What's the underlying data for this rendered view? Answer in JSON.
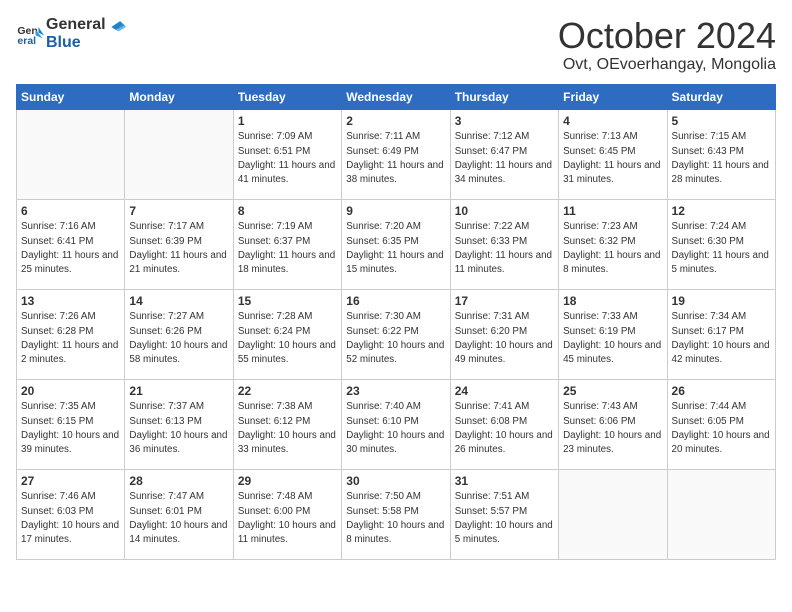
{
  "header": {
    "logo_line1": "General",
    "logo_line2": "Blue",
    "month": "October 2024",
    "location": "Ovt, OEvoerhangay, Mongolia"
  },
  "days_of_week": [
    "Sunday",
    "Monday",
    "Tuesday",
    "Wednesday",
    "Thursday",
    "Friday",
    "Saturday"
  ],
  "weeks": [
    [
      {
        "day": "",
        "info": ""
      },
      {
        "day": "",
        "info": ""
      },
      {
        "day": "1",
        "info": "Sunrise: 7:09 AM\nSunset: 6:51 PM\nDaylight: 11 hours and 41 minutes."
      },
      {
        "day": "2",
        "info": "Sunrise: 7:11 AM\nSunset: 6:49 PM\nDaylight: 11 hours and 38 minutes."
      },
      {
        "day": "3",
        "info": "Sunrise: 7:12 AM\nSunset: 6:47 PM\nDaylight: 11 hours and 34 minutes."
      },
      {
        "day": "4",
        "info": "Sunrise: 7:13 AM\nSunset: 6:45 PM\nDaylight: 11 hours and 31 minutes."
      },
      {
        "day": "5",
        "info": "Sunrise: 7:15 AM\nSunset: 6:43 PM\nDaylight: 11 hours and 28 minutes."
      }
    ],
    [
      {
        "day": "6",
        "info": "Sunrise: 7:16 AM\nSunset: 6:41 PM\nDaylight: 11 hours and 25 minutes."
      },
      {
        "day": "7",
        "info": "Sunrise: 7:17 AM\nSunset: 6:39 PM\nDaylight: 11 hours and 21 minutes."
      },
      {
        "day": "8",
        "info": "Sunrise: 7:19 AM\nSunset: 6:37 PM\nDaylight: 11 hours and 18 minutes."
      },
      {
        "day": "9",
        "info": "Sunrise: 7:20 AM\nSunset: 6:35 PM\nDaylight: 11 hours and 15 minutes."
      },
      {
        "day": "10",
        "info": "Sunrise: 7:22 AM\nSunset: 6:33 PM\nDaylight: 11 hours and 11 minutes."
      },
      {
        "day": "11",
        "info": "Sunrise: 7:23 AM\nSunset: 6:32 PM\nDaylight: 11 hours and 8 minutes."
      },
      {
        "day": "12",
        "info": "Sunrise: 7:24 AM\nSunset: 6:30 PM\nDaylight: 11 hours and 5 minutes."
      }
    ],
    [
      {
        "day": "13",
        "info": "Sunrise: 7:26 AM\nSunset: 6:28 PM\nDaylight: 11 hours and 2 minutes."
      },
      {
        "day": "14",
        "info": "Sunrise: 7:27 AM\nSunset: 6:26 PM\nDaylight: 10 hours and 58 minutes."
      },
      {
        "day": "15",
        "info": "Sunrise: 7:28 AM\nSunset: 6:24 PM\nDaylight: 10 hours and 55 minutes."
      },
      {
        "day": "16",
        "info": "Sunrise: 7:30 AM\nSunset: 6:22 PM\nDaylight: 10 hours and 52 minutes."
      },
      {
        "day": "17",
        "info": "Sunrise: 7:31 AM\nSunset: 6:20 PM\nDaylight: 10 hours and 49 minutes."
      },
      {
        "day": "18",
        "info": "Sunrise: 7:33 AM\nSunset: 6:19 PM\nDaylight: 10 hours and 45 minutes."
      },
      {
        "day": "19",
        "info": "Sunrise: 7:34 AM\nSunset: 6:17 PM\nDaylight: 10 hours and 42 minutes."
      }
    ],
    [
      {
        "day": "20",
        "info": "Sunrise: 7:35 AM\nSunset: 6:15 PM\nDaylight: 10 hours and 39 minutes."
      },
      {
        "day": "21",
        "info": "Sunrise: 7:37 AM\nSunset: 6:13 PM\nDaylight: 10 hours and 36 minutes."
      },
      {
        "day": "22",
        "info": "Sunrise: 7:38 AM\nSunset: 6:12 PM\nDaylight: 10 hours and 33 minutes."
      },
      {
        "day": "23",
        "info": "Sunrise: 7:40 AM\nSunset: 6:10 PM\nDaylight: 10 hours and 30 minutes."
      },
      {
        "day": "24",
        "info": "Sunrise: 7:41 AM\nSunset: 6:08 PM\nDaylight: 10 hours and 26 minutes."
      },
      {
        "day": "25",
        "info": "Sunrise: 7:43 AM\nSunset: 6:06 PM\nDaylight: 10 hours and 23 minutes."
      },
      {
        "day": "26",
        "info": "Sunrise: 7:44 AM\nSunset: 6:05 PM\nDaylight: 10 hours and 20 minutes."
      }
    ],
    [
      {
        "day": "27",
        "info": "Sunrise: 7:46 AM\nSunset: 6:03 PM\nDaylight: 10 hours and 17 minutes."
      },
      {
        "day": "28",
        "info": "Sunrise: 7:47 AM\nSunset: 6:01 PM\nDaylight: 10 hours and 14 minutes."
      },
      {
        "day": "29",
        "info": "Sunrise: 7:48 AM\nSunset: 6:00 PM\nDaylight: 10 hours and 11 minutes."
      },
      {
        "day": "30",
        "info": "Sunrise: 7:50 AM\nSunset: 5:58 PM\nDaylight: 10 hours and 8 minutes."
      },
      {
        "day": "31",
        "info": "Sunrise: 7:51 AM\nSunset: 5:57 PM\nDaylight: 10 hours and 5 minutes."
      },
      {
        "day": "",
        "info": ""
      },
      {
        "day": "",
        "info": ""
      }
    ]
  ]
}
